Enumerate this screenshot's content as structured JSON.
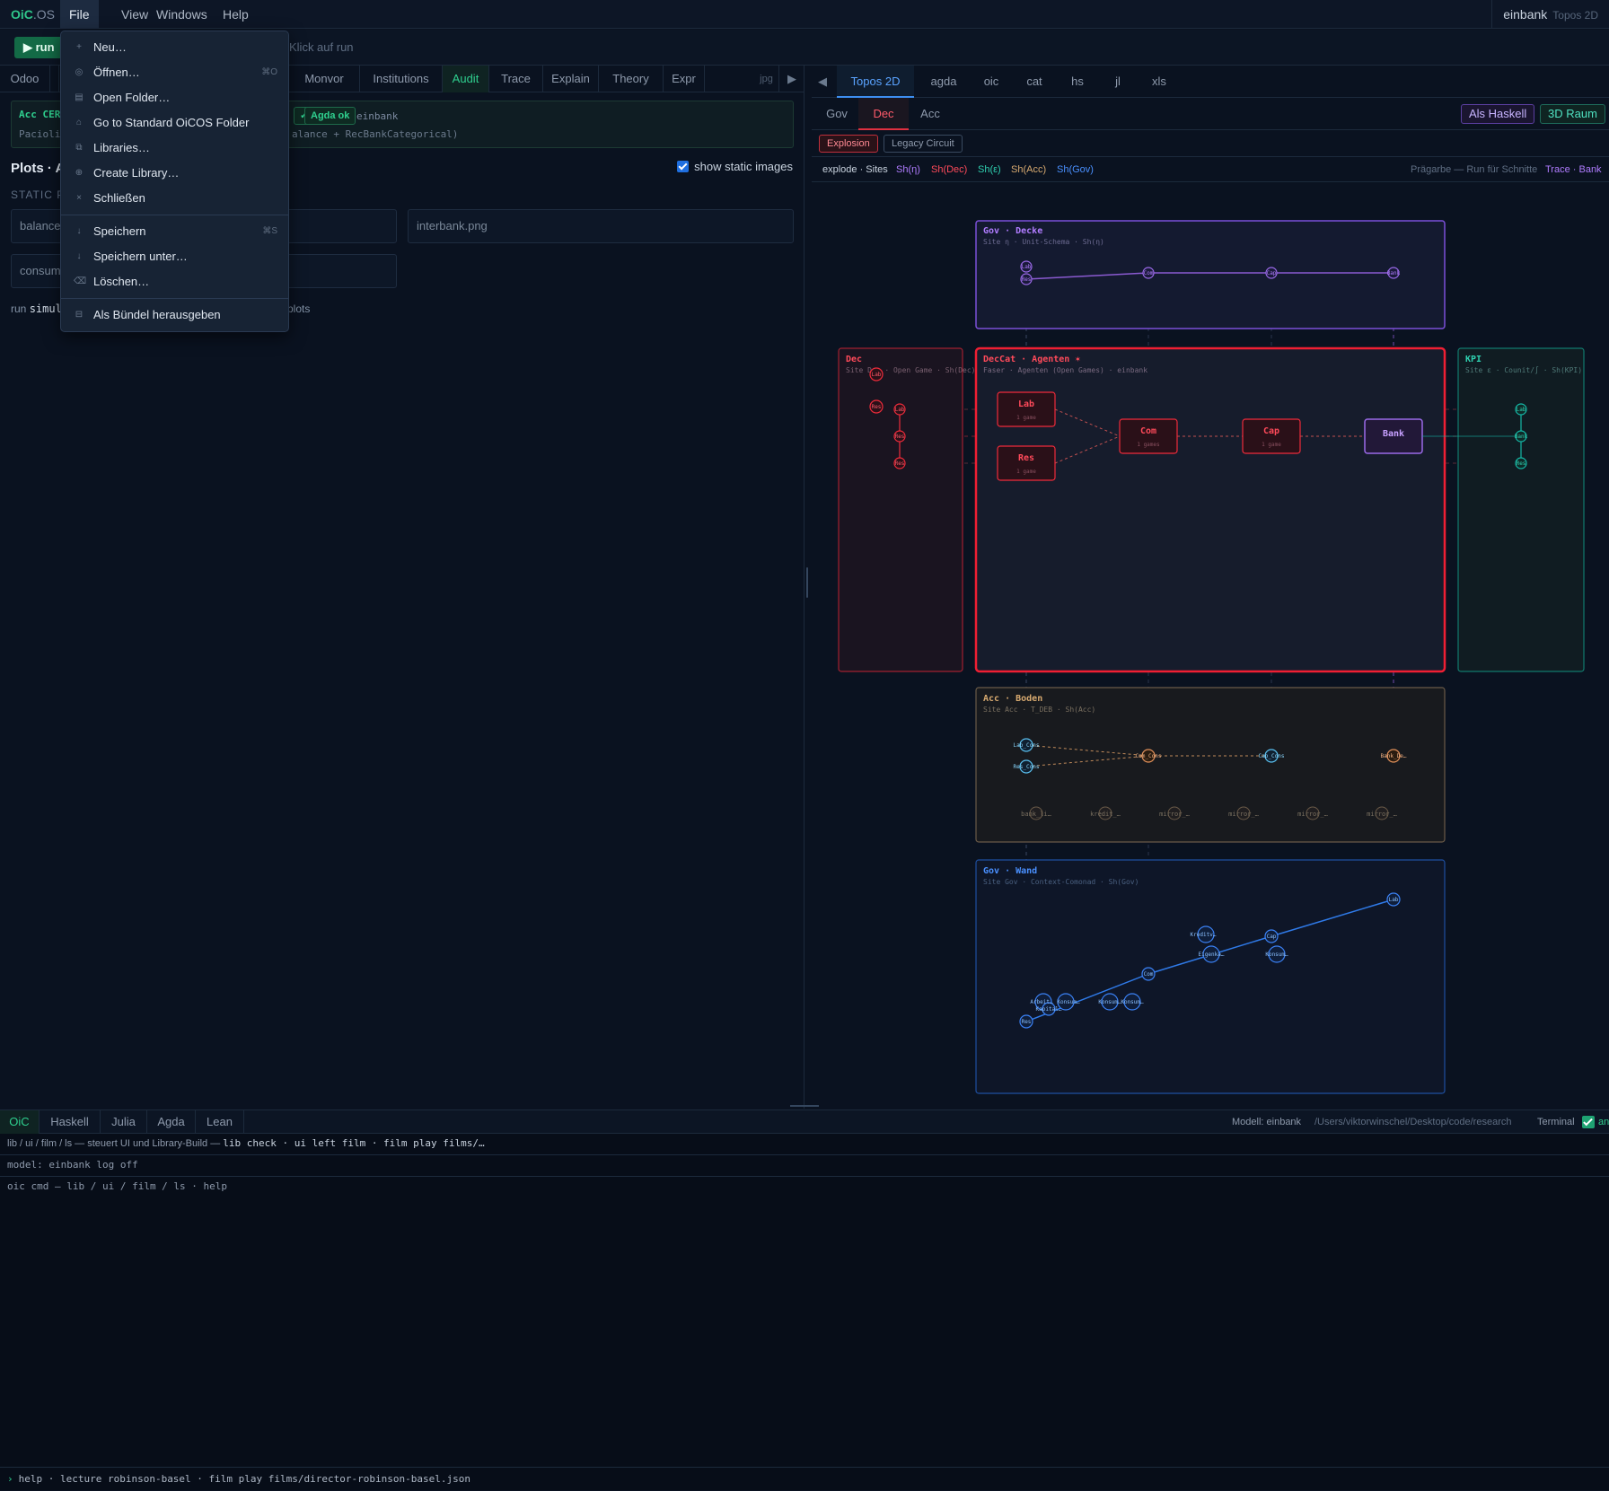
{
  "menubar": {
    "logo": "OiC",
    "logo_suffix": ".OS",
    "items": [
      "File",
      "View",
      "Windows",
      "Help"
    ],
    "user": "einbank",
    "user_sub": "Topos 2D"
  },
  "runbar": {
    "run_label": "▶ run",
    "hint": "Klick auf run"
  },
  "left": {
    "tabs": [
      "Odoo",
      "",
      "",
      "",
      "",
      "",
      "Monvor",
      "Institutions",
      "Audit",
      "Trace",
      "Explain",
      "Theory",
      "Expr",
      "jpg"
    ],
    "active_tab": "Audit",
    "acc_title": "Acc CER",
    "acc_badge1": "✓",
    "acc_badge2": "Agda ok",
    "acc_model": "einbank",
    "acc_line2_a": "Pacioli",
    "acc_line2_b": "alance + RecBankCategorical)",
    "plots_title": "Plots · A",
    "show_static": "show static images",
    "static_label": "STATIC P",
    "images": [
      "balance.",
      "interbank.png",
      "consum"
    ],
    "run_prefix": "run",
    "run_cmd": "simul",
    "run_suffix": "plots"
  },
  "right": {
    "tabs": [
      "Topos 2D",
      "agda",
      "oic",
      "cat",
      "hs",
      "jl",
      "xls"
    ],
    "active_tab": "Topos 2D",
    "subtabs": [
      "Gov",
      "Dec",
      "Acc"
    ],
    "active_subtab": "Dec",
    "btn_haskell": "Als Haskell",
    "btn_3d": "3D Raum",
    "mode_explosion": "Explosion",
    "mode_legacy": "Legacy Circuit",
    "legend": {
      "prefix": "explode · Sites",
      "items": [
        "Sh(η)",
        "Sh(Dec)",
        "Sh(ε)",
        "Sh(Acc)",
        "Sh(Gov)"
      ],
      "right_text": "Prägarbe — Run für Schnitte",
      "right_link": "Trace · Bank"
    },
    "diagram": {
      "gov_decke": {
        "title": "Gov · Decke",
        "sub": "Site η · Unit-Schema · Sh(η)",
        "nodes": [
          "Lab",
          "Res",
          "Com",
          "Cap",
          "Bank"
        ]
      },
      "dec": {
        "title": "Dec",
        "sub": "Site Dec · Open Game · Sh(Dec)",
        "nodes": [
          "Lab",
          "Res",
          "Lab",
          "Res",
          "Res"
        ]
      },
      "deccat": {
        "title": "DecCat · Agenten ✶",
        "sub": "Faser · Agenten (Open Games) · einbank"
      },
      "kpi": {
        "title": "KPI",
        "sub": "Site ε · Counit/∫ · Sh(KPI)",
        "nodes": [
          "Lab",
          "Bank",
          "Res"
        ]
      },
      "boxes": [
        {
          "label": "Lab",
          "sub": "1 game"
        },
        {
          "label": "Res",
          "sub": "1 game"
        },
        {
          "label": "Com",
          "sub": "1 games"
        },
        {
          "label": "Cap",
          "sub": "1 game"
        },
        {
          "label": "Bank",
          "sub": ""
        }
      ],
      "acc_boden": {
        "title": "Acc · Boden",
        "sub": "Site Acc · T_DEB · Sh(Acc)",
        "nodes": [
          "Lab_Cons",
          "Res_Cons",
          "Com_Cons",
          "Cap_Cons",
          "Bank_De…"
        ],
        "bottom": [
          "bank_li…",
          "kredit_…",
          "mirror_…",
          "mirror_…",
          "mirror_…",
          "mirror_…"
        ]
      },
      "gov_wand": {
        "title": "Gov · Wand",
        "sub": "Site Gov · Context-Comonad · Sh(Gov)",
        "nodes": [
          "Res",
          "Arbeit…",
          "Konsum…",
          "Kapital…",
          "Konsum…",
          "Konsum…",
          "Com",
          "Eigenka…",
          "Kreditv…",
          "Cap",
          "Konsum…",
          "Lab"
        ]
      }
    }
  },
  "bottom": {
    "tabs": [
      "OiC",
      "Haskell",
      "Julia",
      "Agda",
      "Lean"
    ],
    "active_tab": "OiC",
    "model": "Modell: einbank",
    "path": "/Users/viktorwinschel/Desktop/code/research",
    "terminal": "Terminal",
    "terminal_state": "an",
    "line1_a": "lib / ui / film / ls — steuert UI und Library-Build —",
    "line1_b": "lib check · ui left film · film play films/…",
    "line2": "model: einbank  log off",
    "line3": "oic cmd — lib / ui / film / ls · help",
    "prompt": "›",
    "cmd": "help · lecture robinson-basel · film play films/director-robinson-basel.json"
  },
  "file_menu": {
    "items": [
      {
        "icon": "+",
        "label": "Neu…",
        "shortcut": ""
      },
      {
        "icon": "◎",
        "label": "Öffnen…",
        "shortcut": "⌘O"
      },
      {
        "icon": "▤",
        "label": "Open Folder…",
        "shortcut": ""
      },
      {
        "icon": "⌂",
        "label": "Go to Standard OiCOS Folder",
        "shortcut": ""
      },
      {
        "icon": "⧉",
        "label": "Libraries…",
        "shortcut": ""
      },
      {
        "icon": "⊕",
        "label": "Create Library…",
        "shortcut": ""
      },
      {
        "icon": "×",
        "label": "Schließen",
        "shortcut": ""
      },
      {
        "icon": "↓",
        "label": "Speichern",
        "shortcut": "⌘S"
      },
      {
        "icon": "↓",
        "label": "Speichern unter…",
        "shortcut": ""
      },
      {
        "icon": "⌫",
        "label": "Löschen…",
        "shortcut": ""
      },
      {
        "icon": "⊟",
        "label": "Als Bündel herausgeben",
        "shortcut": ""
      }
    ]
  },
  "colors": {
    "accent_green": "#2fd08f",
    "eta": "#a855f7",
    "dec": "#ef2b3b",
    "kpi": "#14b8a6",
    "acc": "#c9a06a",
    "gov": "#3b82f6"
  }
}
